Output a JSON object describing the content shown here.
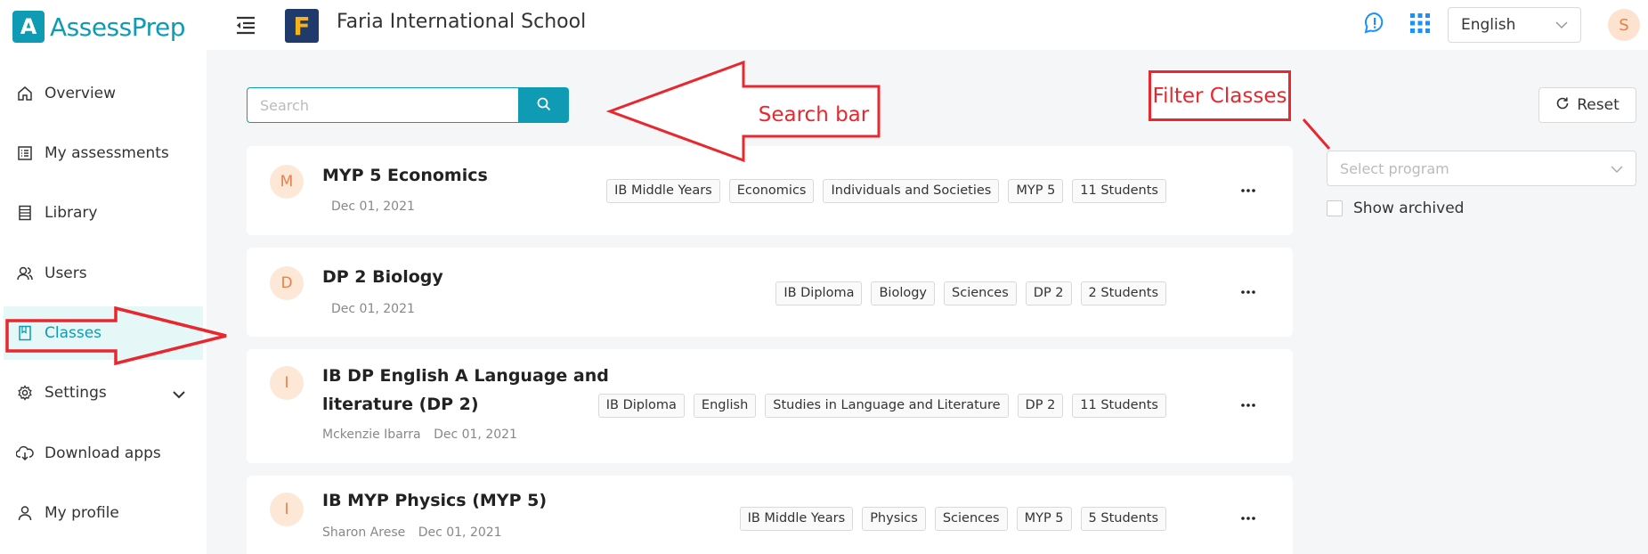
{
  "app": {
    "logo_letter": "A",
    "logo_text": "AssessPrep",
    "school_letter": "F",
    "school_name": "Faria International School"
  },
  "header": {
    "language": "English",
    "user_initial": "S"
  },
  "sidebar": {
    "items": [
      {
        "label": "Overview",
        "icon": "home-icon"
      },
      {
        "label": "My assessments",
        "icon": "list-icon"
      },
      {
        "label": "Library",
        "icon": "book-icon"
      },
      {
        "label": "Users",
        "icon": "users-icon"
      },
      {
        "label": "Classes",
        "icon": "bookmark-icon",
        "active": true
      },
      {
        "label": "Settings",
        "icon": "gear-icon"
      },
      {
        "label": "Download apps",
        "icon": "cloud-download-icon"
      },
      {
        "label": "My profile",
        "icon": "user-icon"
      }
    ]
  },
  "search": {
    "placeholder": "Search"
  },
  "classes": [
    {
      "initial": "M",
      "title": "MYP 5 Economics",
      "teacher": "",
      "date": "Dec 01, 2021",
      "tags": [
        "IB Middle Years",
        "Economics",
        "Individuals and Societies",
        "MYP 5",
        "11 Students"
      ]
    },
    {
      "initial": "D",
      "title": "DP 2 Biology",
      "teacher": "",
      "date": "Dec 01, 2021",
      "tags": [
        "IB Diploma",
        "Biology",
        "Sciences",
        "DP 2",
        "2 Students"
      ]
    },
    {
      "initial": "I",
      "title_line1": "IB DP English A Language and",
      "title_line2": "literature (DP 2)",
      "teacher": "Mckenzie Ibarra",
      "date": "Dec 01, 2021",
      "tags": [
        "IB Diploma",
        "English",
        "Studies in Language and Literature",
        "DP 2",
        "11 Students"
      ]
    },
    {
      "initial": "I",
      "title": "IB MYP Physics (MYP 5)",
      "teacher": "Sharon Arese",
      "date": "Dec 01, 2021",
      "tags": [
        "IB Middle Years",
        "Physics",
        "Sciences",
        "MYP 5",
        "5 Students"
      ]
    }
  ],
  "filters": {
    "reset_label": "Reset",
    "program_placeholder": "Select program",
    "show_archived_label": "Show archived"
  },
  "annotations": {
    "search_bar": "Search bar",
    "filter_classes": "Filter Classes"
  },
  "colors": {
    "accent": "#0f9bb3",
    "annotation": "#e8272e"
  }
}
